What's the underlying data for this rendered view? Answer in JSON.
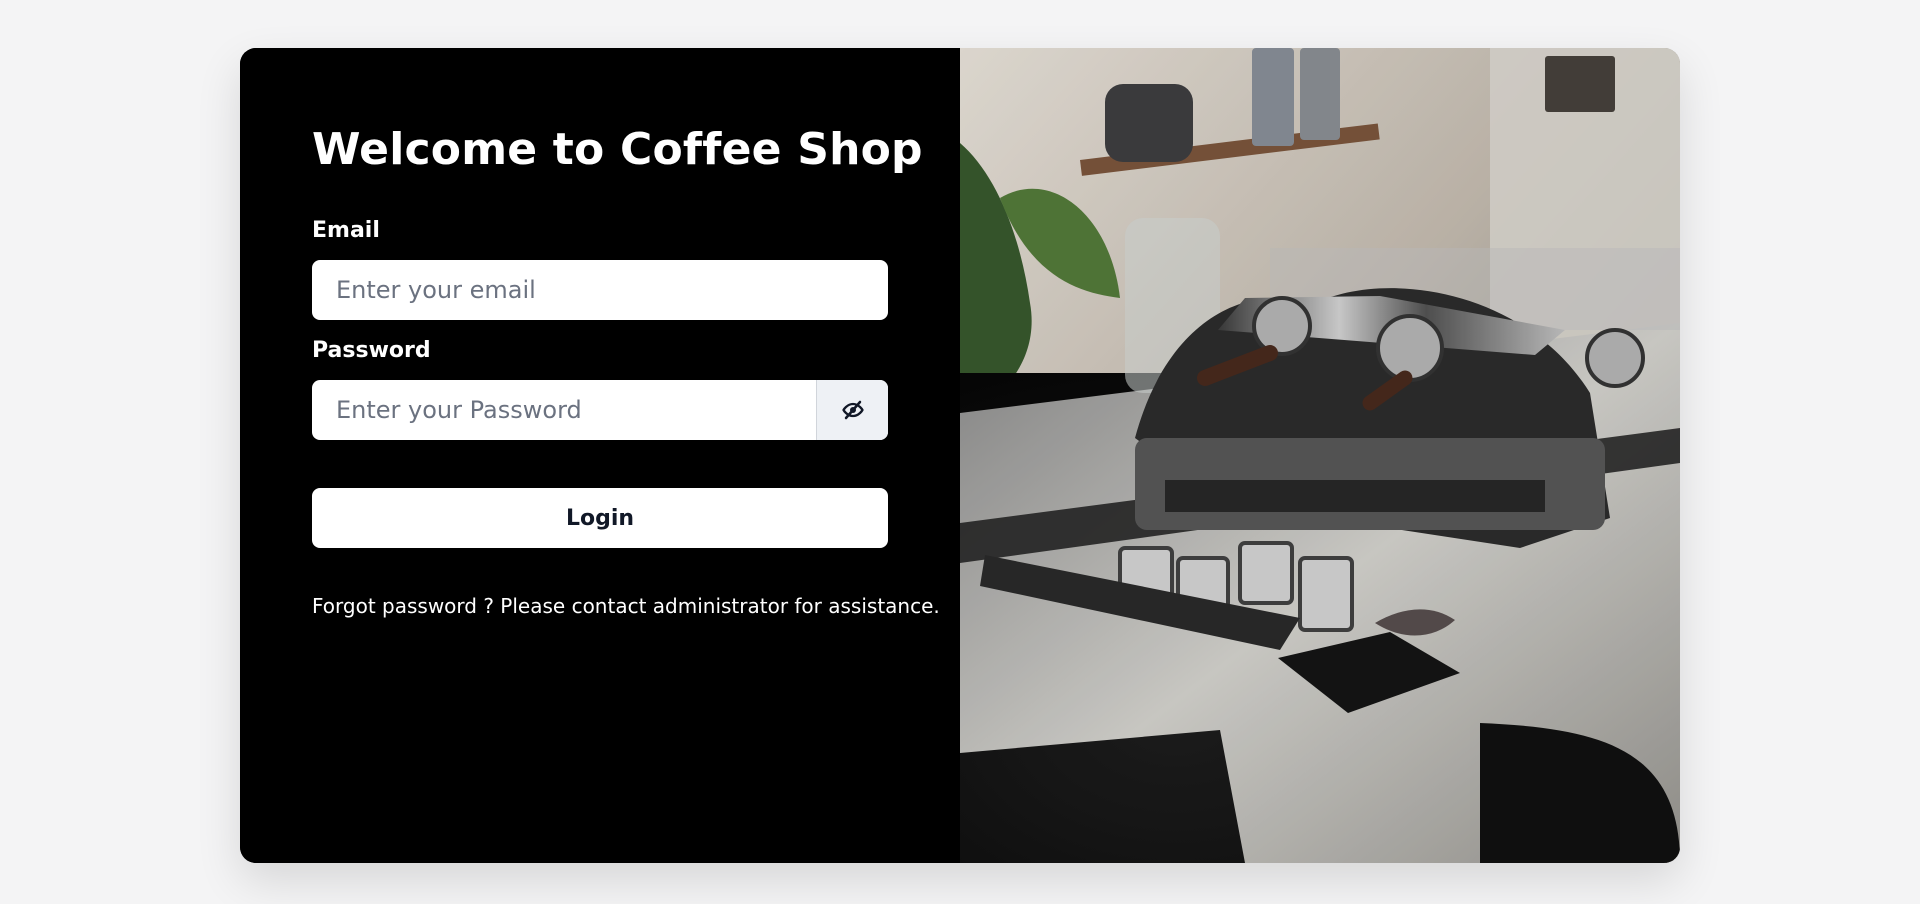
{
  "page": {
    "title": "Welcome to Coffee Shop"
  },
  "form": {
    "email_label": "Email",
    "email_placeholder": "Enter your email",
    "password_label": "Password",
    "password_placeholder": "Enter your Password",
    "toggle_icon": "eye-off-icon",
    "login_label": "Login",
    "help_text": "Forgot password ? Please contact administrator for assistance."
  },
  "colors": {
    "page_background": "#f4f4f5",
    "panel_background": "#000000",
    "panel_text": "#ffffff",
    "input_background": "#ffffff",
    "placeholder": "#6b7280",
    "toggle_background": "#eef1f5"
  }
}
